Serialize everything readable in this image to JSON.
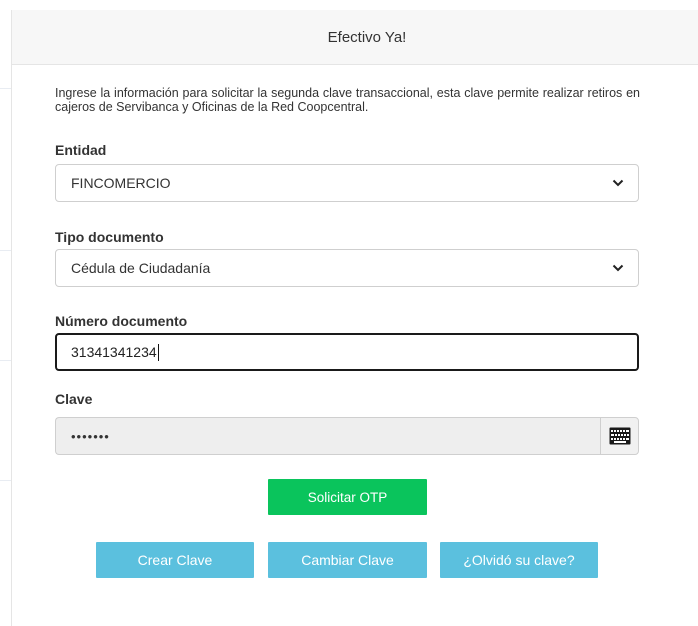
{
  "modal": {
    "title": "Efectivo Ya!"
  },
  "intro_text": "Ingrese la información para solicitar la segunda clave transaccional, esta clave permite realizar retiros en cajeros de Servibanca y Oficinas de la Red Coopcentral.",
  "form": {
    "entidad": {
      "label": "Entidad",
      "value": "FINCOMERCIO"
    },
    "tipo_documento": {
      "label": "Tipo documento",
      "value": "Cédula de Ciudadanía"
    },
    "numero_documento": {
      "label": "Número documento",
      "value": "31341341234"
    },
    "clave": {
      "label": "Clave",
      "value": "•••••••",
      "keyboard_icon": "keyboard-icon"
    }
  },
  "buttons": {
    "solicitar_otp": "Solicitar OTP",
    "crear_clave": "Crear Clave",
    "cambiar_clave": "Cambiar Clave",
    "olvido_clave": "¿Olvidó su clave?"
  },
  "colors": {
    "primary_green": "#0ac45c",
    "info_blue": "#5bc0de",
    "header_bg": "#f7f7f7",
    "disabled_bg": "#eeeeee"
  }
}
